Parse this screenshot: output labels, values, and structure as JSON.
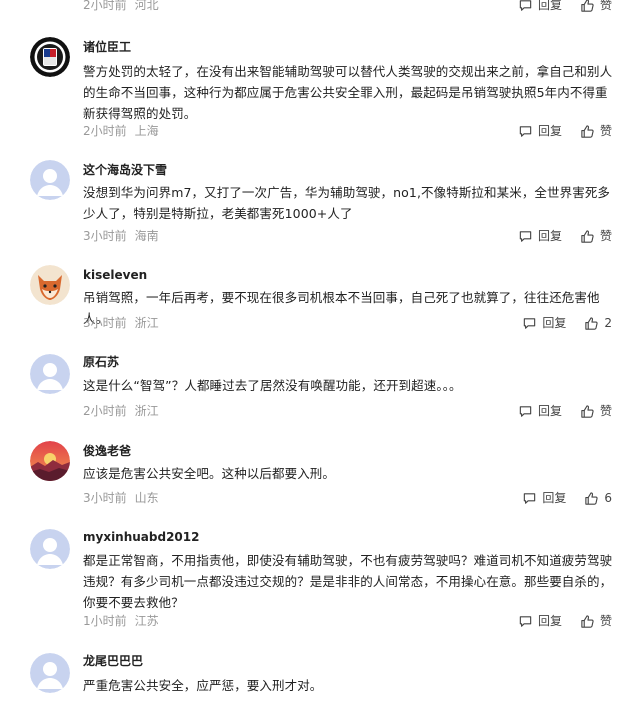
{
  "top_partial": {
    "time": "2小时前",
    "location": "河北",
    "reply_label": "回复",
    "like_label": "赞"
  },
  "comments": [
    {
      "user": "诸位臣工",
      "avatar_icon": "alpina-badge-avatar",
      "text": "警方处罚的太轻了，在没有出来智能辅助驾驶可以替代人类驾驶的交规出来之前，拿自己和别人的生命不当回事，这种行为都应属于危害公共安全罪入刑，最起码是吊销驾驶执照5年内不得重新获得驾照的处罚。",
      "time": "2小时前",
      "location": "上海",
      "reply_label": "回复",
      "like_label": "赞"
    },
    {
      "user": "这个海岛没下雪",
      "avatar_icon": "default-user-avatar",
      "text": "没想到华为问界m7，又打了一次广告，华为辅助驾驶，no1,不像特斯拉和某米，全世界害死多少人了，特别是特斯拉，老美都害死1000+人了",
      "time": "3小时前",
      "location": "海南",
      "reply_label": "回复",
      "like_label": "赞"
    },
    {
      "user": "kiseleven",
      "avatar_icon": "fox-cartoon-avatar",
      "text": "吊销驾照，一年后再考，要不现在很多司机根本不当回事，自己死了也就算了，往往还危害他人。",
      "time": "3小时前",
      "location": "浙江",
      "reply_label": "回复",
      "like_label": "2"
    },
    {
      "user": "原石苏",
      "avatar_icon": "default-user-avatar",
      "text": "这是什么“智驾”？人都睡过去了居然没有唤醒功能，还开到超速。。。",
      "time": "2小时前",
      "location": "浙江",
      "reply_label": "回复",
      "like_label": "赞"
    },
    {
      "user": "俊逸老爸",
      "avatar_icon": "sunset-landscape-avatar",
      "text": "应该是危害公共安全吧。这种以后都要入刑。",
      "time": "3小时前",
      "location": "山东",
      "reply_label": "回复",
      "like_label": "6"
    },
    {
      "user": "myxinhuabd2012",
      "avatar_icon": "default-user-avatar",
      "text": "都是正常智商，不用指责他，即使没有辅助驾驶，不也有疲劳驾驶吗？难道司机不知道疲劳驾驶违规？有多少司机一点都没违过交规的？是是非非的人间常态，不用操心在意。那些要自杀的，你要不要去救他？",
      "time": "1小时前",
      "location": "江苏",
      "reply_label": "回复",
      "like_label": "赞"
    },
    {
      "user": "龙尾巴巴巴",
      "avatar_icon": "default-user-avatar",
      "text": "严重危害公共安全，应严惩，要入刑才对。"
    }
  ]
}
